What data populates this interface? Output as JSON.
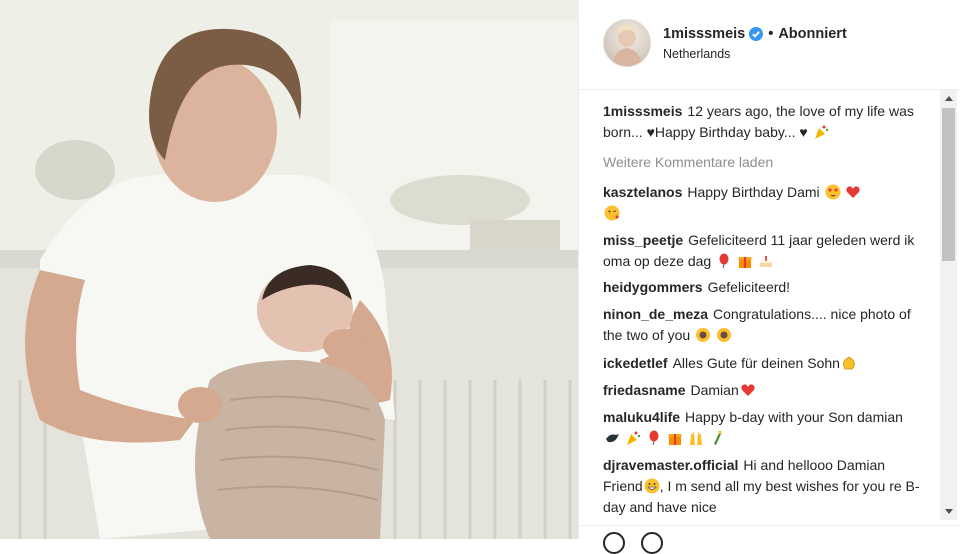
{
  "photo": {
    "alt_subject": "mother-holding-newborn"
  },
  "header": {
    "username": "1misssmeis",
    "separator": "•",
    "follow_label": "Abonniert",
    "location": "Netherlands",
    "verified_icon": "verified-badge-icon"
  },
  "caption": {
    "username": "1misssmeis",
    "text": "12 years ago, the love of my life was born... ♥Happy Birthday baby... ♥"
  },
  "load_more_label": "Weitere Kommentare laden",
  "comments": [
    {
      "username": "kasztelanos",
      "text": "Happy Birthday Dami",
      "emojis": [
        "heart-eyes",
        "red-heart",
        "kiss-face"
      ]
    },
    {
      "username": "miss_peetje",
      "text": "Gefeliciteerd 11 jaar geleden werd ik oma op deze dag",
      "emojis": [
        "balloon",
        "gift",
        "cake"
      ]
    },
    {
      "username": "heidygommers",
      "text": "Gefeliciteerd!",
      "emojis": []
    },
    {
      "username": "ninon_de_meza",
      "text": "Congratulations.... nice photo of the two of you",
      "emojis": [
        "sunflower",
        "sunflower"
      ]
    },
    {
      "username": "ickedetlef",
      "text": "Alles Gute für deinen Sohn",
      "emojis": [
        "clap"
      ]
    },
    {
      "username": "friedasname",
      "text": "Damian",
      "emojis": [
        "red-heart"
      ]
    },
    {
      "username": "maluku4life",
      "text": "Happy b-day with your Son damian",
      "emojis": [
        "dove",
        "party-popper",
        "balloon",
        "gift",
        "raised-hands",
        "champagne"
      ]
    },
    {
      "username": "djravemaster.official",
      "text": "Hi and hellooo Damian Friend",
      "text2": ", I m send all my best wishes for you re B-day and have nice",
      "emojis": [
        "grin"
      ]
    }
  ],
  "colors": {
    "text": "#262626",
    "muted": "#8e8e8e",
    "verified": "#3897f0",
    "divider": "#efefef"
  }
}
